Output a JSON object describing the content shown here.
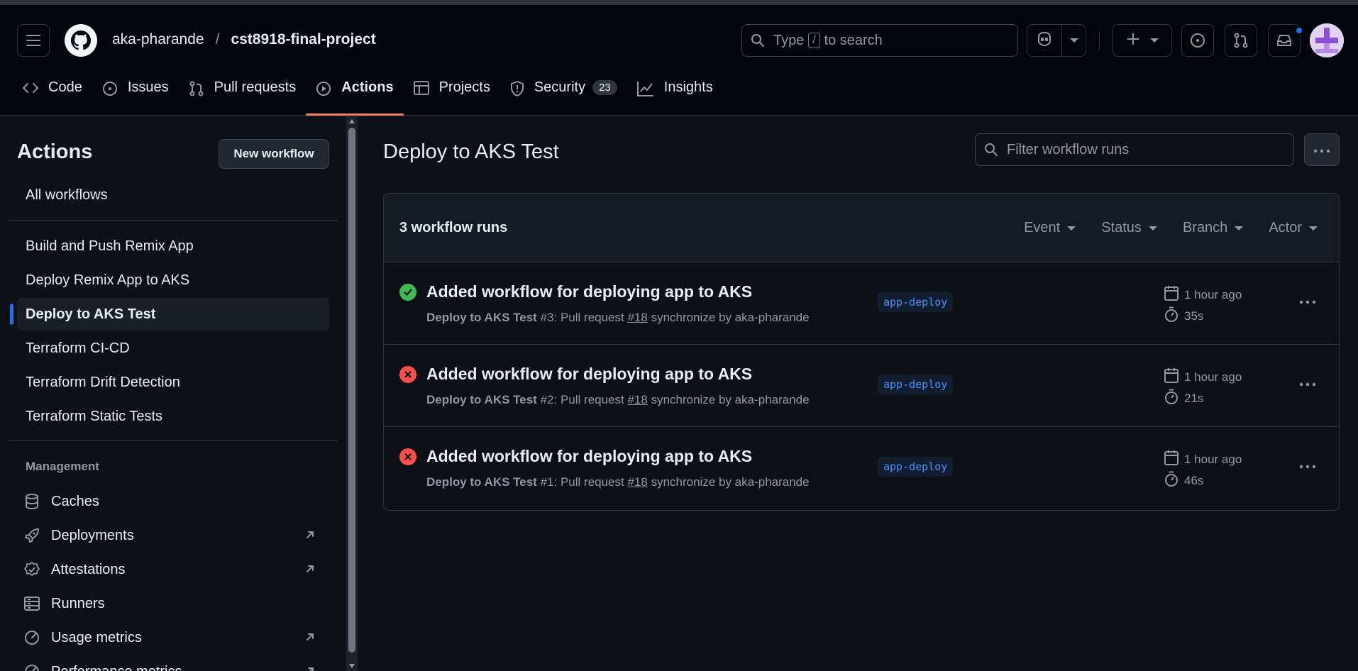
{
  "header": {
    "owner": "aka-pharande",
    "separator": "/",
    "repo": "cst8918-final-project",
    "search": {
      "prefix": "Type",
      "key": "/",
      "suffix": "to search"
    }
  },
  "repo_nav": {
    "tabs": [
      {
        "label": "Code",
        "icon": "code-icon"
      },
      {
        "label": "Issues",
        "icon": "issue-icon"
      },
      {
        "label": "Pull requests",
        "icon": "pull-request-icon"
      },
      {
        "label": "Actions",
        "icon": "play-icon",
        "active": true
      },
      {
        "label": "Projects",
        "icon": "table-icon"
      },
      {
        "label": "Security",
        "icon": "shield-icon",
        "counter": "23"
      },
      {
        "label": "Insights",
        "icon": "graph-icon"
      }
    ]
  },
  "sidebar": {
    "title": "Actions",
    "new_workflow": "New workflow",
    "all_workflows": "All workflows",
    "workflows": [
      "Build and Push Remix App",
      "Deploy Remix App to AKS",
      "Deploy to AKS Test",
      "Terraform CI-CD",
      "Terraform Drift Detection",
      "Terraform Static Tests"
    ],
    "active_workflow": "Deploy to AKS Test",
    "management_heading": "Management",
    "management": [
      {
        "label": "Caches",
        "icon": "database-icon",
        "external": false
      },
      {
        "label": "Deployments",
        "icon": "rocket-icon",
        "external": true
      },
      {
        "label": "Attestations",
        "icon": "verified-icon",
        "external": true
      },
      {
        "label": "Runners",
        "icon": "server-icon",
        "external": false
      },
      {
        "label": "Usage metrics",
        "icon": "meter-icon",
        "external": true
      },
      {
        "label": "Performance metrics",
        "icon": "meter-icon",
        "external": true
      }
    ]
  },
  "main": {
    "title": "Deploy to AKS Test",
    "filter_placeholder": "Filter workflow runs",
    "runs_count": "3 workflow runs",
    "filters": [
      "Event",
      "Status",
      "Branch",
      "Actor"
    ],
    "runs": [
      {
        "status": "success",
        "title": "Added workflow for deploying app to AKS",
        "workflow": "Deploy to AKS Test",
        "number": "#3",
        "meta_mid": ": Pull request ",
        "pr": "#18",
        "meta_tail": " synchronize by aka-pharande",
        "branch": "app-deploy",
        "when": "1 hour ago",
        "duration": "35s"
      },
      {
        "status": "failure",
        "title": "Added workflow for deploying app to AKS",
        "workflow": "Deploy to AKS Test",
        "number": "#2",
        "meta_mid": ": Pull request ",
        "pr": "#18",
        "meta_tail": " synchronize by aka-pharande",
        "branch": "app-deploy",
        "when": "1 hour ago",
        "duration": "21s"
      },
      {
        "status": "failure",
        "title": "Added workflow for deploying app to AKS",
        "workflow": "Deploy to AKS Test",
        "number": "#1",
        "meta_mid": ": Pull request ",
        "pr": "#18",
        "meta_tail": " synchronize by aka-pharande",
        "branch": "app-deploy",
        "when": "1 hour ago",
        "duration": "46s"
      }
    ]
  },
  "colors": {
    "background": "#0d1117",
    "header_bg": "#010409",
    "accent_tab": "#f78166",
    "success": "#3fb950",
    "failure": "#f85149",
    "link": "#4493f8",
    "active_marker": "#1f6feb"
  }
}
